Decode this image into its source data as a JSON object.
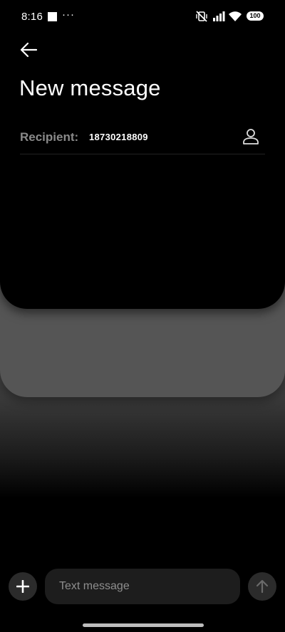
{
  "status_bar": {
    "time": "8:16",
    "dots": "···",
    "battery": "100",
    "icons": [
      "notification-square-icon",
      "mute-vibrate-icon",
      "signal-icon",
      "wifi-icon",
      "battery-icon"
    ]
  },
  "header": {
    "back_icon": "arrow-left-icon",
    "title": "New message"
  },
  "recipient": {
    "label": "Recipient:",
    "value": "18730218809",
    "contact_icon": "person-icon"
  },
  "composer": {
    "placeholder": "Text message",
    "add_icon": "plus-icon",
    "send_icon": "arrow-up-icon"
  },
  "colors": {
    "background": "#000000",
    "card_back": "#555555",
    "input_bg": "#1d1d1d",
    "label_gray": "#8a8a8a"
  }
}
